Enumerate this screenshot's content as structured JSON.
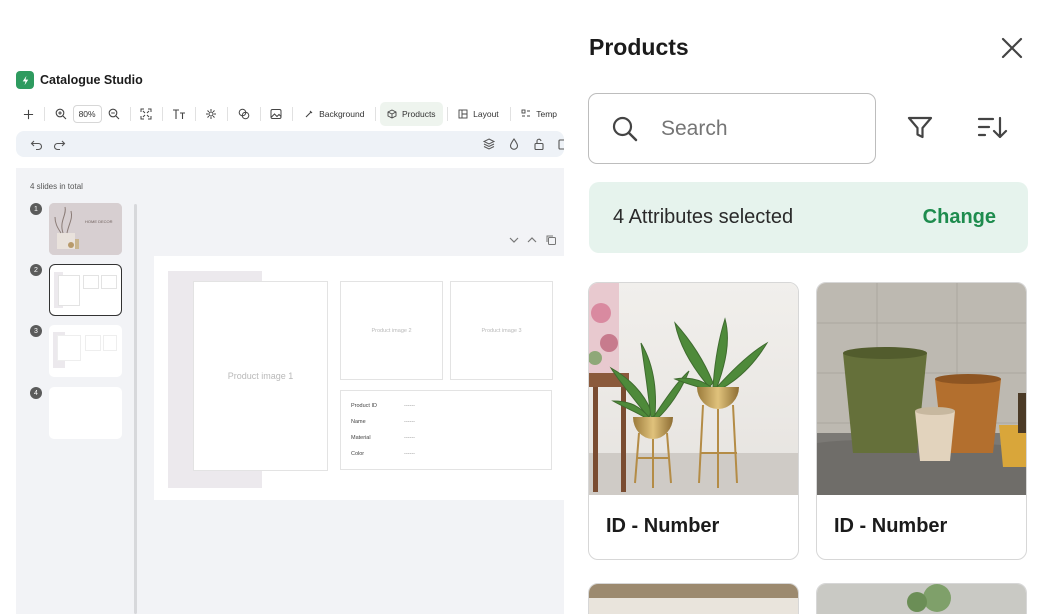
{
  "app": {
    "name": "Catalogue Studio"
  },
  "toolbar": {
    "zoom": "80%",
    "background_label": "Background",
    "products_label": "Products",
    "layout_label": "Layout",
    "templates_label": "Temp"
  },
  "slides": {
    "total_text": "4 slides in total",
    "numbers": [
      "1",
      "2",
      "3",
      "4"
    ],
    "slide1_text": "HOME DECOR"
  },
  "canvas": {
    "product_image_1": "Product image 1",
    "product_image_2": "Product image 2",
    "product_image_3": "Product image 3",
    "fields": [
      {
        "label": "Product ID",
        "value": "------"
      },
      {
        "label": "Name",
        "value": "------"
      },
      {
        "label": "Material",
        "value": "------"
      },
      {
        "label": "Color",
        "value": "------"
      }
    ]
  },
  "panel": {
    "title": "Products",
    "search_placeholder": "Search",
    "attributes_text": "4 Attributes selected",
    "change_label": "Change",
    "cards": [
      {
        "label": "ID - Number"
      },
      {
        "label": "ID - Number"
      }
    ]
  },
  "colors": {
    "accent_green": "#1e8c4e",
    "attr_bg": "#e6f3ed",
    "canvas_bg": "#f2f3f6"
  }
}
